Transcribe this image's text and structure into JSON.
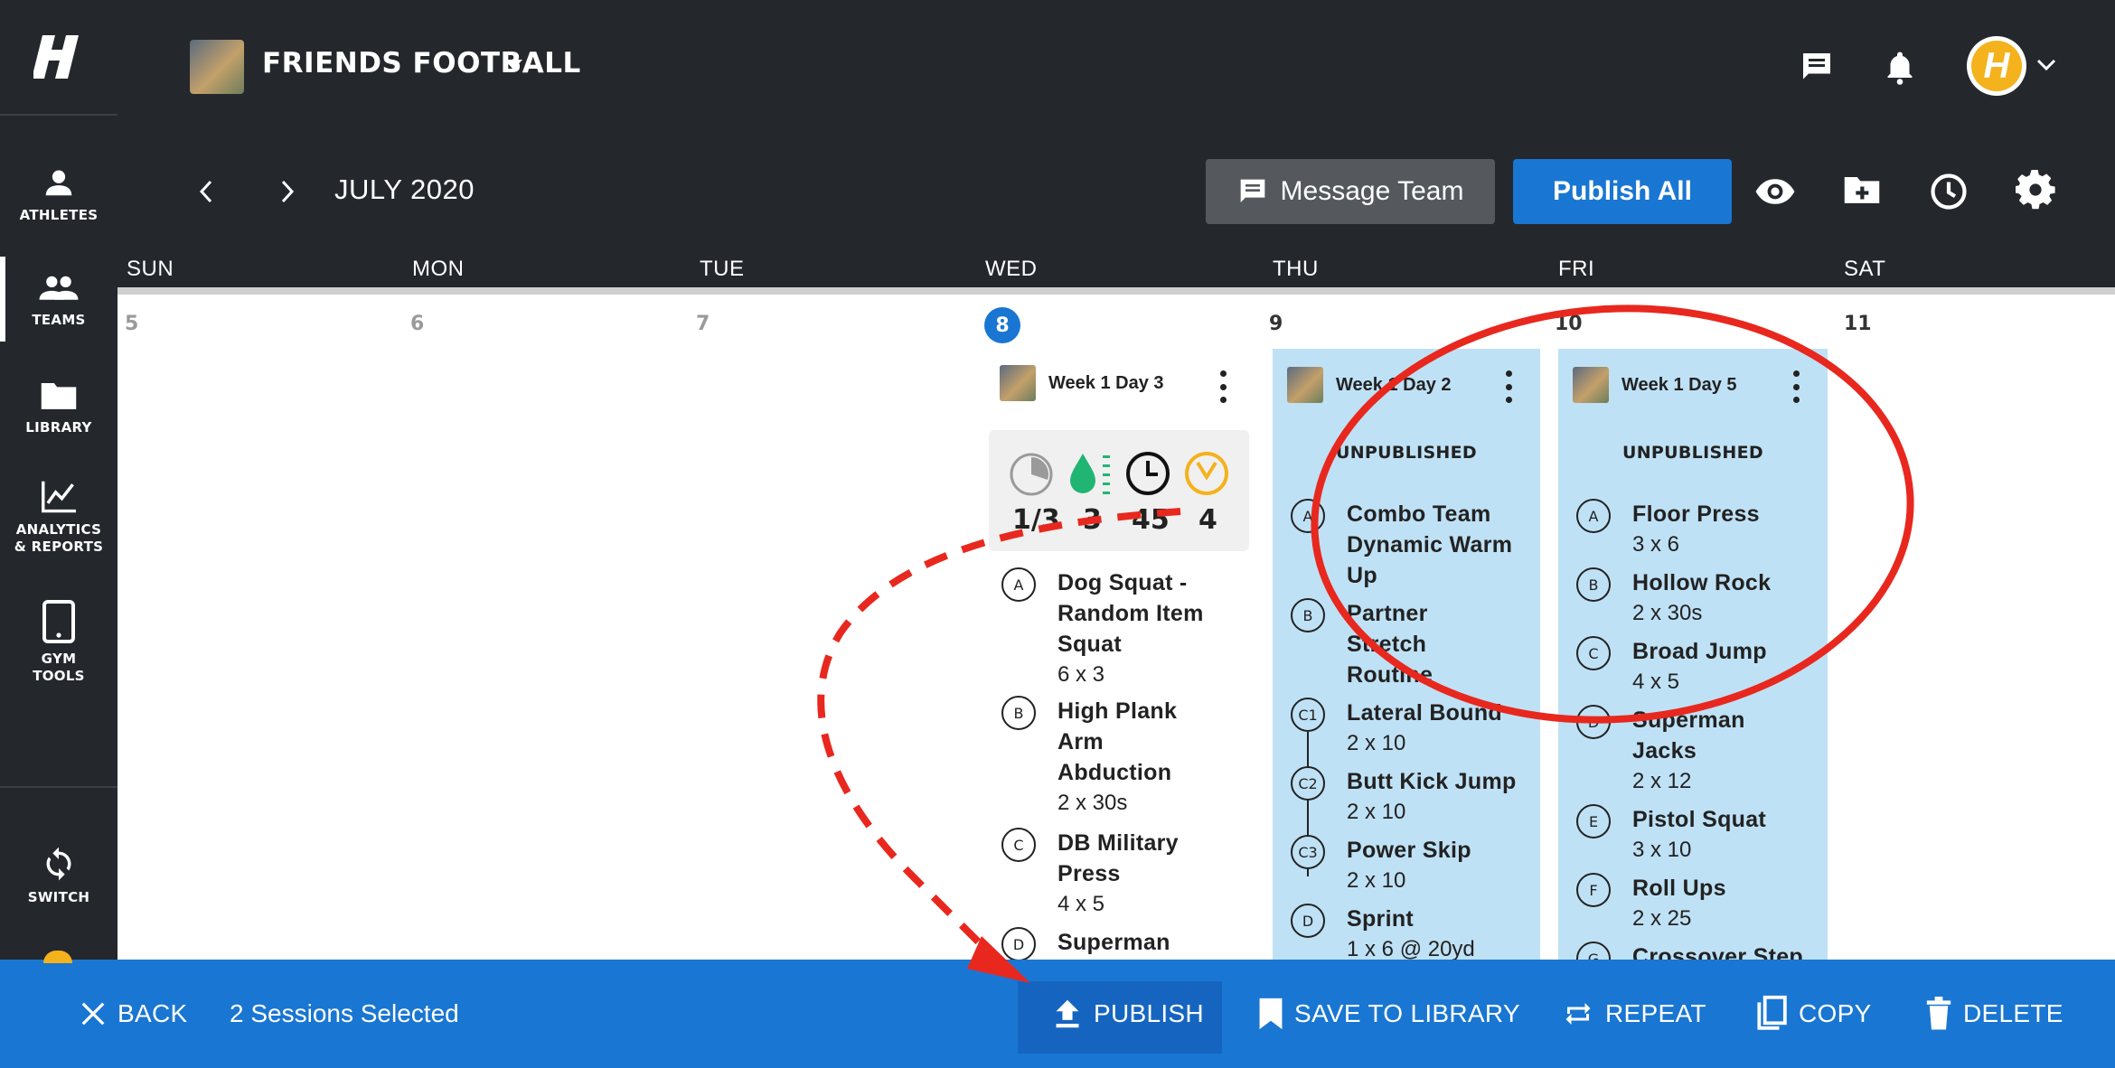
{
  "app": {
    "logo_icon": "h-logo-icon"
  },
  "sidebar": {
    "items": [
      {
        "label": "ATHLETES",
        "icon": "person-icon"
      },
      {
        "label": "TEAMS",
        "icon": "group-icon"
      },
      {
        "label": "LIBRARY",
        "icon": "folder-icon"
      },
      {
        "label": "ANALYTICS & REPORTS",
        "icon": "chart-icon"
      },
      {
        "label": "GYM TOOLS",
        "icon": "tablet-icon"
      },
      {
        "label": "SWITCH",
        "icon": "switch-icon"
      }
    ]
  },
  "header": {
    "team_name": "FRIENDS FOOTBALL",
    "month": "JULY 2020",
    "message_team_label": "Message Team",
    "publish_all_label": "Publish All",
    "avatar_letter": "H"
  },
  "calendar": {
    "days_of_week": [
      "SUN",
      "MON",
      "TUE",
      "WED",
      "THU",
      "FRI",
      "SAT"
    ],
    "dates": [
      "5",
      "6",
      "7",
      "8",
      "9",
      "10",
      "11"
    ],
    "today_index": 3
  },
  "sessions": {
    "wed": {
      "title": "Week 1 Day 3",
      "stats": {
        "completed": "1/3",
        "hydration": "3",
        "duration": "45",
        "other": "4"
      },
      "exercises": [
        {
          "badge": "A",
          "name": "Dog Squat - Random Item Squat",
          "rx": "6 x 3"
        },
        {
          "badge": "B",
          "name": "High Plank Arm Abduction",
          "rx": "2 x 30s"
        },
        {
          "badge": "C",
          "name": "DB Military Press",
          "rx": "4 x 5"
        },
        {
          "badge": "D",
          "name": "Superman",
          "rx": ""
        }
      ]
    },
    "thu": {
      "title": "Week 1 Day 2",
      "status": "UNPUBLISHED",
      "exercises": [
        {
          "badge": "A",
          "name": "Combo Team Dynamic Warm Up",
          "rx": ""
        },
        {
          "badge": "B",
          "name": "Partner Stretch Routine",
          "rx": ""
        },
        {
          "badge": "C1",
          "name": "Lateral Bound",
          "rx": "2 x 10"
        },
        {
          "badge": "C2",
          "name": "Butt Kick Jump",
          "rx": "2 x 10"
        },
        {
          "badge": "C3",
          "name": "Power Skip",
          "rx": "2 x 10"
        },
        {
          "badge": "D",
          "name": "Sprint",
          "rx": "1 x 6 @ 20yd"
        }
      ]
    },
    "fri": {
      "title": "Week 1 Day 5",
      "status": "UNPUBLISHED",
      "exercises": [
        {
          "badge": "A",
          "name": "Floor Press",
          "rx": "3 x 6"
        },
        {
          "badge": "B",
          "name": "Hollow Rock",
          "rx": "2 x 30s"
        },
        {
          "badge": "C",
          "name": "Broad Jump",
          "rx": "4 x 5"
        },
        {
          "badge": "D",
          "name": "Superman Jacks",
          "rx": "2 x 12"
        },
        {
          "badge": "E",
          "name": "Pistol Squat",
          "rx": "3 x 10"
        },
        {
          "badge": "F",
          "name": "Roll Ups",
          "rx": "2 x 25"
        },
        {
          "badge": "G",
          "name": "Crossover Step",
          "rx": ""
        }
      ]
    }
  },
  "actionbar": {
    "back_label": "BACK",
    "selected_text": "2 Sessions Selected",
    "publish_label": "PUBLISH",
    "save_label": "SAVE TO LIBRARY",
    "repeat_label": "REPEAT",
    "copy_label": "COPY",
    "delete_label": "DELETE"
  },
  "colors": {
    "sidebar_bg": "#24272c",
    "accent_blue": "#1976d2",
    "selected_session_bg": "#bfe1f5",
    "annotation_red": "#e8281e",
    "hydration_green": "#21b573",
    "gold": "#f4b21c"
  }
}
